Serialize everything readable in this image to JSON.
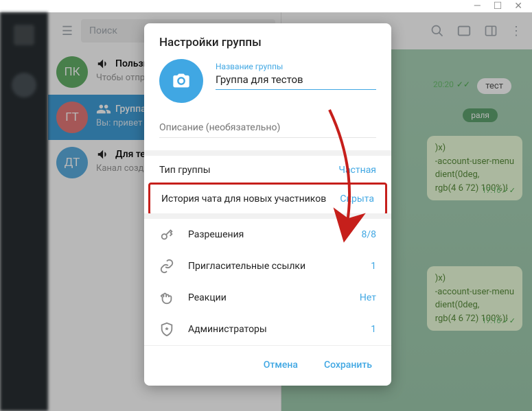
{
  "window_controls": {
    "min": "—",
    "max": "☐",
    "close": "✕"
  },
  "search": {
    "placeholder": "Поиск"
  },
  "chats": [
    {
      "avatar": "ПК",
      "color": "#64b168",
      "title": "Пользне",
      "sub": "Чтобы отпр"
    },
    {
      "avatar": "ГТ",
      "color": "#e57979",
      "title": "Группа д",
      "sub": "Вы: привет"
    },
    {
      "avatar": "ДТ",
      "color": "#5caee0",
      "title": "Для тест",
      "sub": "Канал созда"
    }
  ],
  "header_icons": [
    "search",
    "gif",
    "panel",
    "more"
  ],
  "tag": "тест",
  "tag_time": "20:20",
  "date_label": "раля",
  "bubble_text": ")x)\n-account-user-menu\ndient(0deg,\nrgb(4 6 72) 100%)!",
  "bubble_time": "17:16",
  "modal": {
    "title": "Настройки группы",
    "name_label": "Название группы",
    "name_value": "Группа для тестов",
    "desc_placeholder": "Описание (необязательно)",
    "type_label": "Тип группы",
    "type_value": "Частная",
    "history_label": "История чата для новых участников",
    "history_value": "Скрыта",
    "permissions_label": "Разрешения",
    "permissions_value": "8/8",
    "invite_label": "Пригласительные ссылки",
    "invite_value": "1",
    "reactions_label": "Реакции",
    "reactions_value": "Нет",
    "admins_label": "Администраторы",
    "admins_value": "1",
    "cancel": "Отмена",
    "save": "Сохранить"
  }
}
